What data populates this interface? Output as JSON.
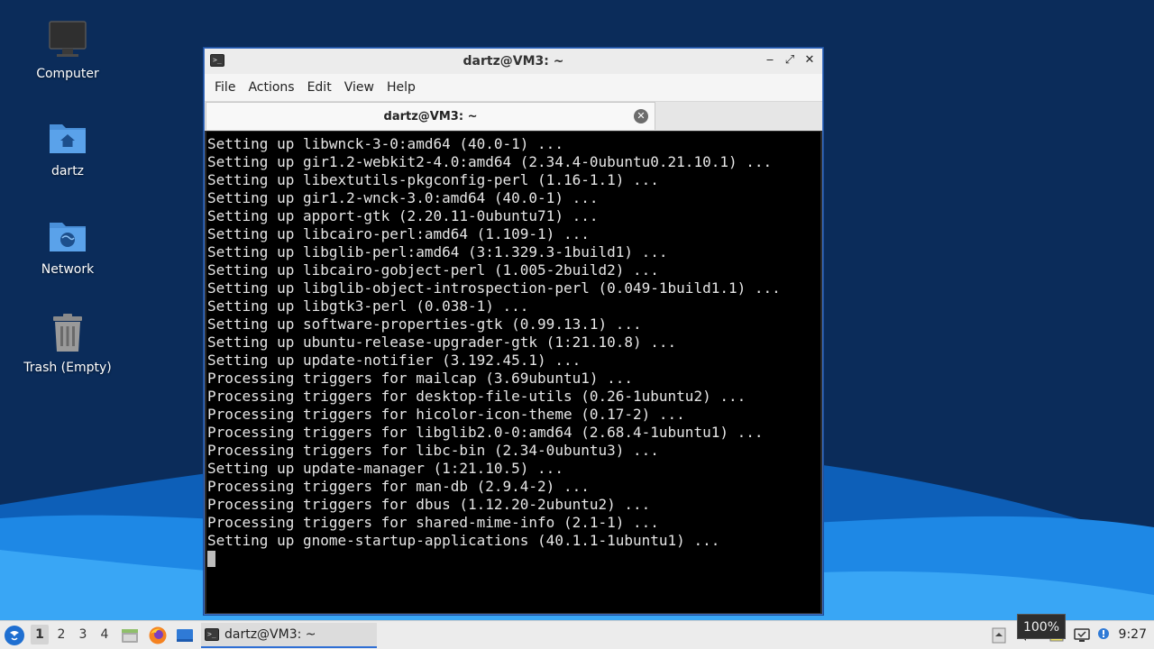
{
  "colors": {
    "wallpaper_dark": "#0b2c5a",
    "wallpaper_wave": "#1e88e5",
    "terminal_bg": "#000000",
    "terminal_fg": "#e6e6e6",
    "window_border": "#3d6fc2",
    "taskbar_bg": "#ececec",
    "task_accent": "#2f6fd4"
  },
  "desktop": {
    "icons": [
      {
        "label": "Computer",
        "icon": "monitor-icon"
      },
      {
        "label": "dartz",
        "icon": "home-folder-icon"
      },
      {
        "label": "Network",
        "icon": "network-folder-icon"
      },
      {
        "label": "Trash (Empty)",
        "icon": "trash-icon"
      }
    ]
  },
  "window": {
    "title": "dartz@VM3: ~",
    "controls": {
      "minimize": "‒",
      "maximize": "⤢",
      "close": "✕"
    },
    "menu": [
      "File",
      "Actions",
      "Edit",
      "View",
      "Help"
    ],
    "tab": {
      "label": "dartz@VM3: ~",
      "close": "✕"
    }
  },
  "terminal": {
    "lines": [
      "Setting up libwnck-3-0:amd64 (40.0-1) ...",
      "Setting up gir1.2-webkit2-4.0:amd64 (2.34.4-0ubuntu0.21.10.1) ...",
      "Setting up libextutils-pkgconfig-perl (1.16-1.1) ...",
      "Setting up gir1.2-wnck-3.0:amd64 (40.0-1) ...",
      "Setting up apport-gtk (2.20.11-0ubuntu71) ...",
      "Setting up libcairo-perl:amd64 (1.109-1) ...",
      "Setting up libglib-perl:amd64 (3:1.329.3-1build1) ...",
      "Setting up libcairo-gobject-perl (1.005-2build2) ...",
      "Setting up libglib-object-introspection-perl (0.049-1build1.1) ...",
      "Setting up libgtk3-perl (0.038-1) ...",
      "Setting up software-properties-gtk (0.99.13.1) ...",
      "Setting up ubuntu-release-upgrader-gtk (1:21.10.8) ...",
      "Setting up update-notifier (3.192.45.1) ...",
      "Processing triggers for mailcap (3.69ubuntu1) ...",
      "Processing triggers for desktop-file-utils (0.26-1ubuntu2) ...",
      "Processing triggers for hicolor-icon-theme (0.17-2) ...",
      "Processing triggers for libglib2.0-0:amd64 (2.68.4-1ubuntu1) ...",
      "Processing triggers for libc-bin (2.34-0ubuntu3) ...",
      "Setting up update-manager (1:21.10.5) ...",
      "Processing triggers for man-db (2.9.4-2) ...",
      "Processing triggers for dbus (1.12.20-2ubuntu2) ...",
      "Processing triggers for shared-mime-info (2.1-1) ...",
      "Setting up gnome-startup-applications (40.1.1-1ubuntu1) ..."
    ]
  },
  "taskbar": {
    "workspaces": [
      "1",
      "2",
      "3",
      "4"
    ],
    "active_workspace": "1",
    "launchers": [
      "file-manager-icon",
      "firefox-icon",
      "show-desktop-icon"
    ],
    "task_label": "dartz@VM3: ~",
    "tooltip": "100%",
    "clock": "9:27"
  }
}
